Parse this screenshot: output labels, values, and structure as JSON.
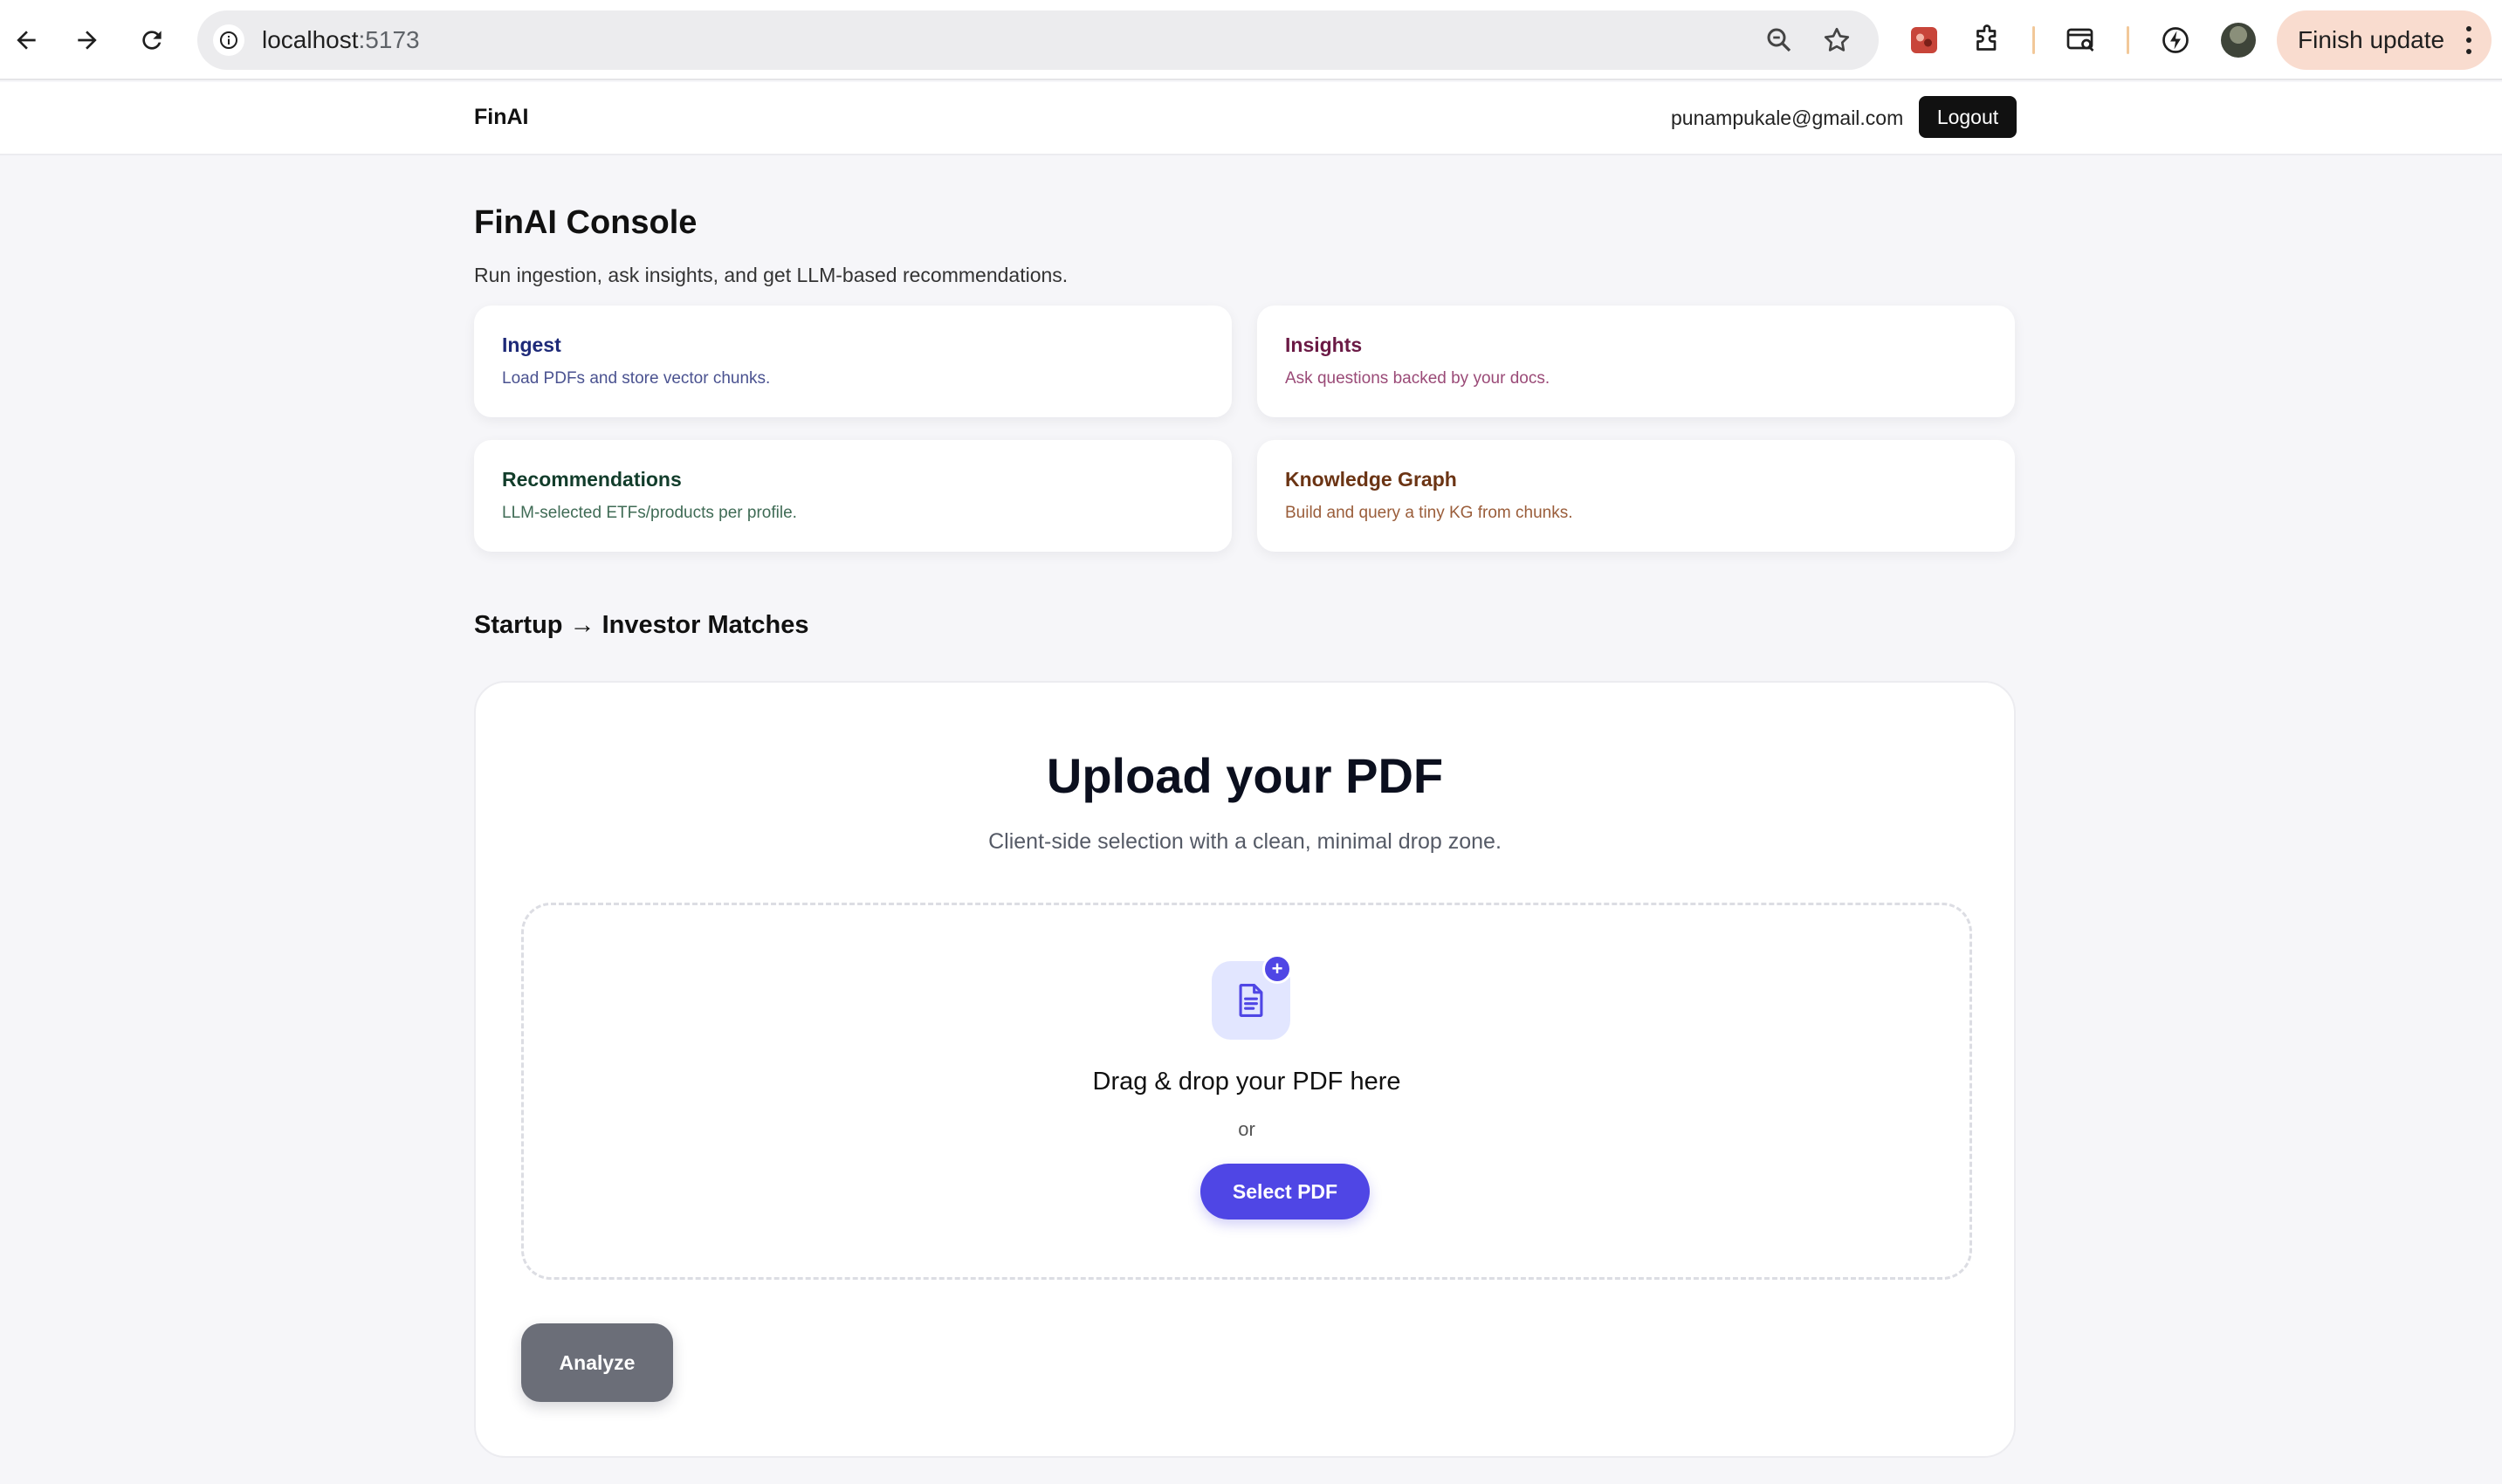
{
  "browser": {
    "url_host": "localhost",
    "url_port": ":5173",
    "finish_update_label": "Finish update"
  },
  "header": {
    "brand": "FinAI",
    "user_email": "punampukale@gmail.com",
    "logout_label": "Logout"
  },
  "page": {
    "title": "FinAI Console",
    "subtitle": "Run ingestion, ask insights, and get LLM-based recommendations."
  },
  "cards": [
    {
      "title": "Ingest",
      "description": "Load PDFs and store vector chunks."
    },
    {
      "title": "Insights",
      "description": "Ask questions backed by your docs."
    },
    {
      "title": "Recommendations",
      "description": "LLM-selected ETFs/products per profile."
    },
    {
      "title": "Knowledge Graph",
      "description": "Build and query a tiny KG from chunks."
    }
  ],
  "section": {
    "title": "Startup → Investor Matches"
  },
  "upload": {
    "title": "Upload your PDF",
    "subtitle": "Client-side selection with a clean, minimal drop zone.",
    "drop_text": "Drag & drop your PDF here",
    "or_text": "or",
    "select_label": "Select PDF",
    "badge_symbol": "+",
    "analyze_label": "Analyze"
  },
  "colors": {
    "accent": "#4f46e5",
    "analyze_bg": "#6b6e78",
    "logout_bg": "#111111"
  }
}
